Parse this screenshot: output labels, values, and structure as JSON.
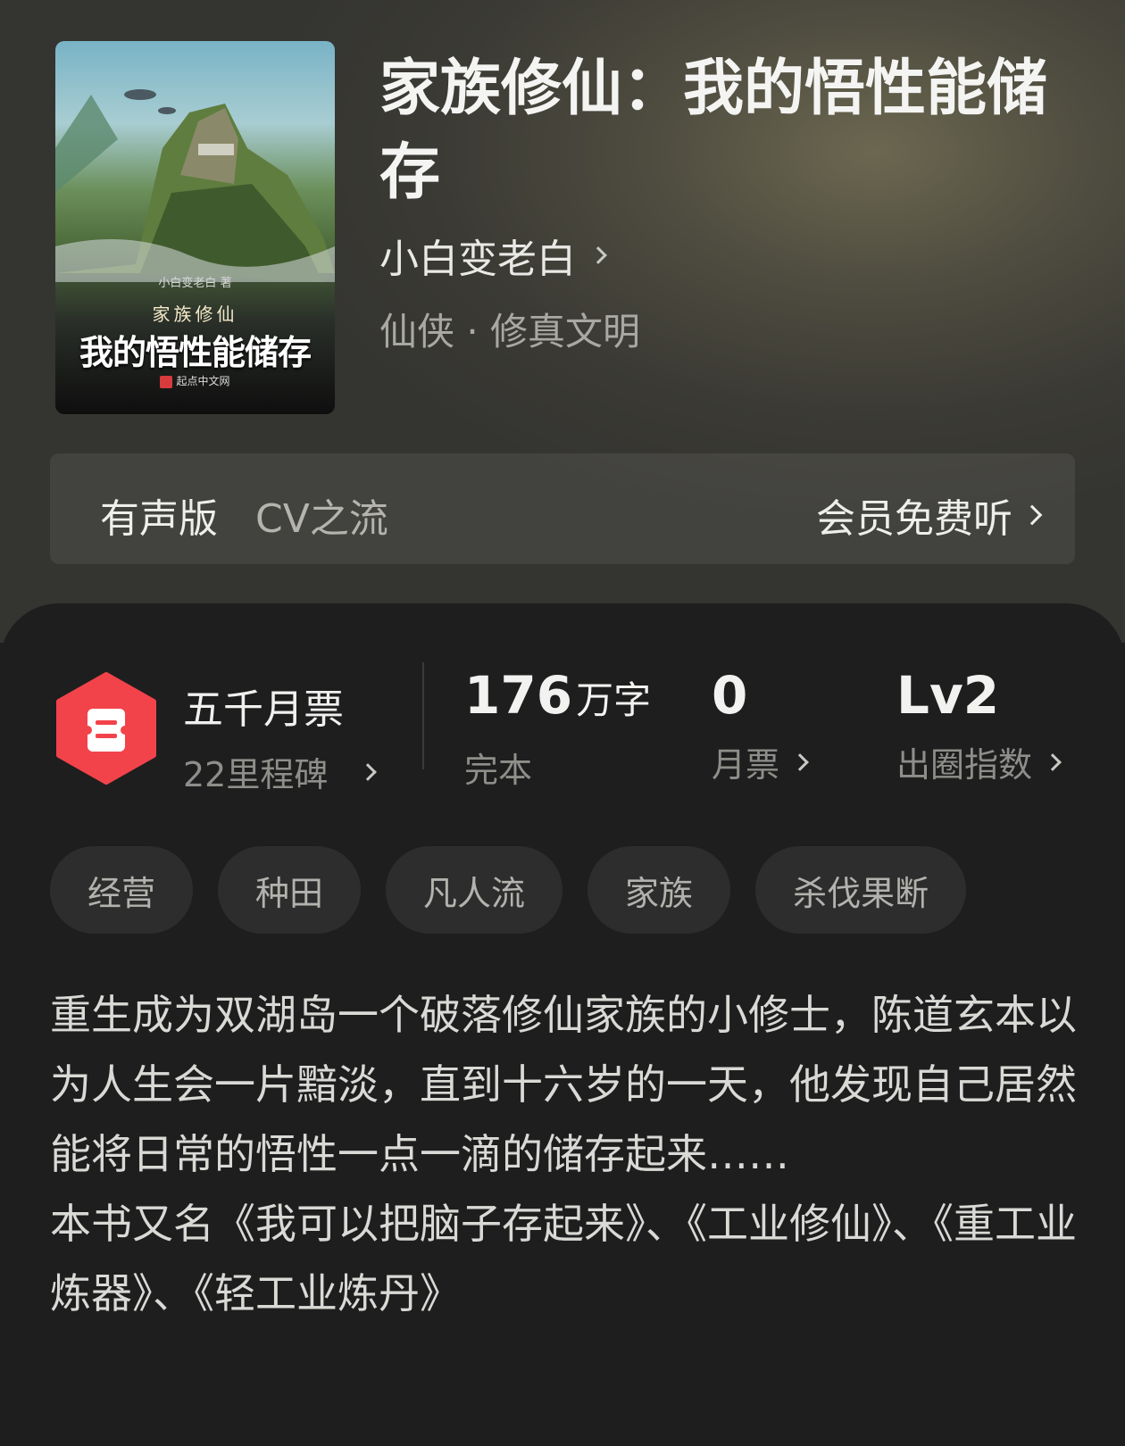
{
  "cover": {
    "author": "小白变老白",
    "author_suffix": "著",
    "series": "家族修仙",
    "title": "我的悟性能储存",
    "publisher": "起点中文网"
  },
  "book": {
    "title": "家族修仙：我的悟性能储存",
    "author": "小白变老白",
    "genre": "仙侠 · 修真文明"
  },
  "audio": {
    "label": "有声版",
    "narrator": "CV之流",
    "action": "会员免费听"
  },
  "badge": {
    "icon": "ticket-icon",
    "title": "五千月票",
    "subtitle": "22里程碑"
  },
  "stats": [
    {
      "value": "176",
      "unit": "万字",
      "label": "完本"
    },
    {
      "value": "0",
      "unit": "",
      "label": "月票"
    },
    {
      "value": "Lv2",
      "unit": "",
      "label": "出圈指数"
    }
  ],
  "tags": [
    "经营",
    "种田",
    "凡人流",
    "家族",
    "杀伐果断"
  ],
  "description": "重生成为双湖岛一个破落修仙家族的小修士，陈道玄本以为人生会一片黯淡，直到十六岁的一天，他发现自己居然能将日常的悟性一点一滴的储存起来……\n本书又名《我可以把脑子存起来》、《工业修仙》、《重工业炼器》、《轻工业炼丹》",
  "colors": {
    "badge_red": "#f2434b",
    "panel_bg": "#1e1e1e",
    "tag_bg": "#2d2d2d"
  }
}
